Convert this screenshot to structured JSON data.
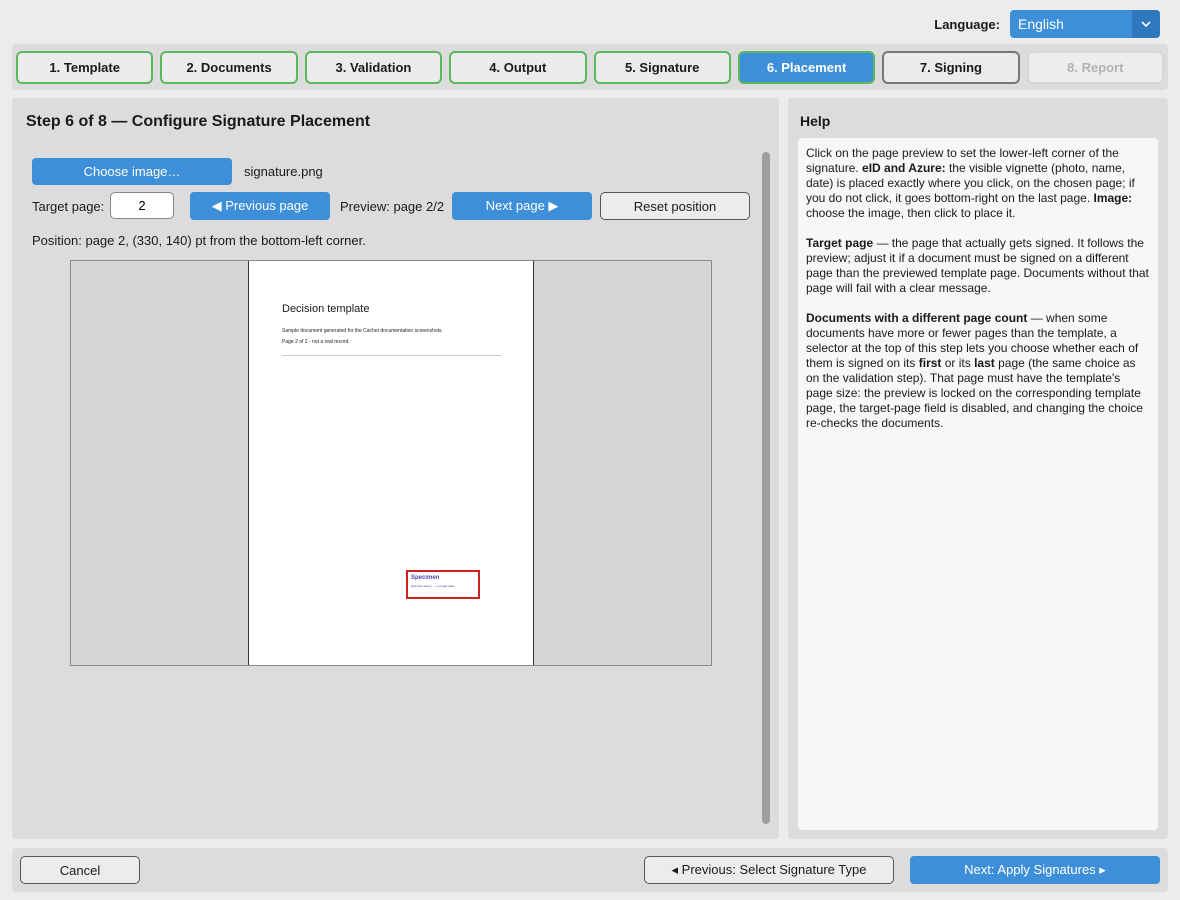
{
  "language": {
    "label": "Language:",
    "value": "English",
    "icon": "chevron-down-icon"
  },
  "steps": [
    {
      "label": "1. Template",
      "state": "done"
    },
    {
      "label": "2. Documents",
      "state": "done"
    },
    {
      "label": "3. Validation",
      "state": "done"
    },
    {
      "label": "4. Output",
      "state": "done"
    },
    {
      "label": "5. Signature",
      "state": "done"
    },
    {
      "label": "6. Placement",
      "state": "active"
    },
    {
      "label": "7. Signing",
      "state": "next"
    },
    {
      "label": "8. Report",
      "state": "disabled"
    }
  ],
  "main": {
    "title": "Step 6 of 8 — Configure Signature Placement",
    "choose_image_label": "Choose image…",
    "file_name": "signature.png",
    "target_page_label": "Target page:",
    "target_page_value": "2",
    "prev_page_label": "◀ Previous page",
    "preview_label": "Preview: page 2/2",
    "next_page_label": "Next page ▶",
    "reset_label": "Reset position",
    "position_text": "Position: page 2, (330, 140) pt from the bottom-left corner."
  },
  "document": {
    "title": "Decision template",
    "line1": "Sample document generated for the Cachet documentation screenshots.",
    "line2": "Page 2 of 2 - not a real record.",
    "sig_name": "Specimen",
    "sig_sub": "Example stamp — no legal value"
  },
  "help": {
    "title": "Help",
    "p1_a": "Click on the page preview to set the lower-left corner of the signature. ",
    "p1_b": "eID and Azure:",
    "p1_c": " the visible vignette (photo, name, date) is placed exactly where you click, on the chosen page; if you do not click, it goes bottom-right on the last page. ",
    "p1_d": "Image:",
    "p1_e": " choose the image, then click to place it.",
    "p2_a": "Target page",
    "p2_b": " — the page that actually gets signed. It follows the preview; adjust it if a document must be signed on a different page than the previewed template page. Documents without that page will fail with a clear message.",
    "p3_a": "Documents with a different page count",
    "p3_b": " — when some documents have more or fewer pages than the template, a selector at the top of this step lets you choose whether each of them is signed on its ",
    "p3_c": "first",
    "p3_d": " or its ",
    "p3_e": "last",
    "p3_f": " page (the same choice as on the validation step). That page must have the template's page size: the preview is locked on the corresponding template page, the target-page field is disabled, and changing the choice re-checks the documents."
  },
  "footer": {
    "cancel_label": "Cancel",
    "prev_label": "◂  Previous: Select Signature Type",
    "next_label": "Next: Apply Signatures  ▸"
  },
  "colors": {
    "accent": "#3d8fd9",
    "done_border": "#5cb85c",
    "signature_border": "#cc2222"
  }
}
